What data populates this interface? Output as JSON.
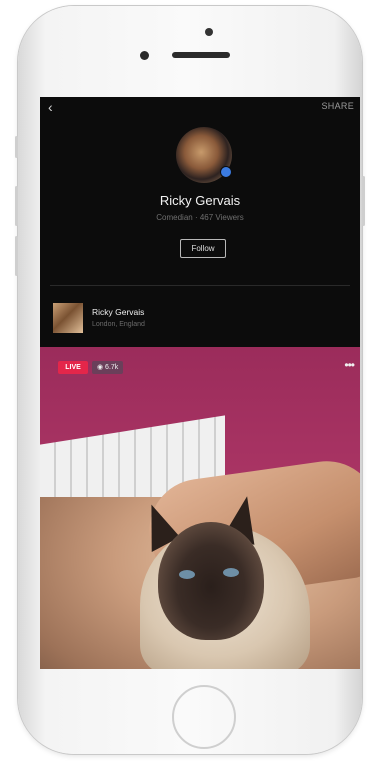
{
  "topbar": {
    "back_glyph": "‹",
    "share_label": "SHARE"
  },
  "profile": {
    "name": "Ricky Gervais",
    "meta": "Comedian · 467 Viewers",
    "follow_label": "Follow"
  },
  "post": {
    "author": "Ricky Gervais",
    "location": "London, England"
  },
  "video": {
    "live_label": "LIVE",
    "viewer_count": "◉ 6.7k",
    "more_glyph": "•••"
  },
  "colors": {
    "live_red": "#e4264a",
    "verified_blue": "#3b7be0",
    "screen_bg": "#0c0c0c"
  }
}
